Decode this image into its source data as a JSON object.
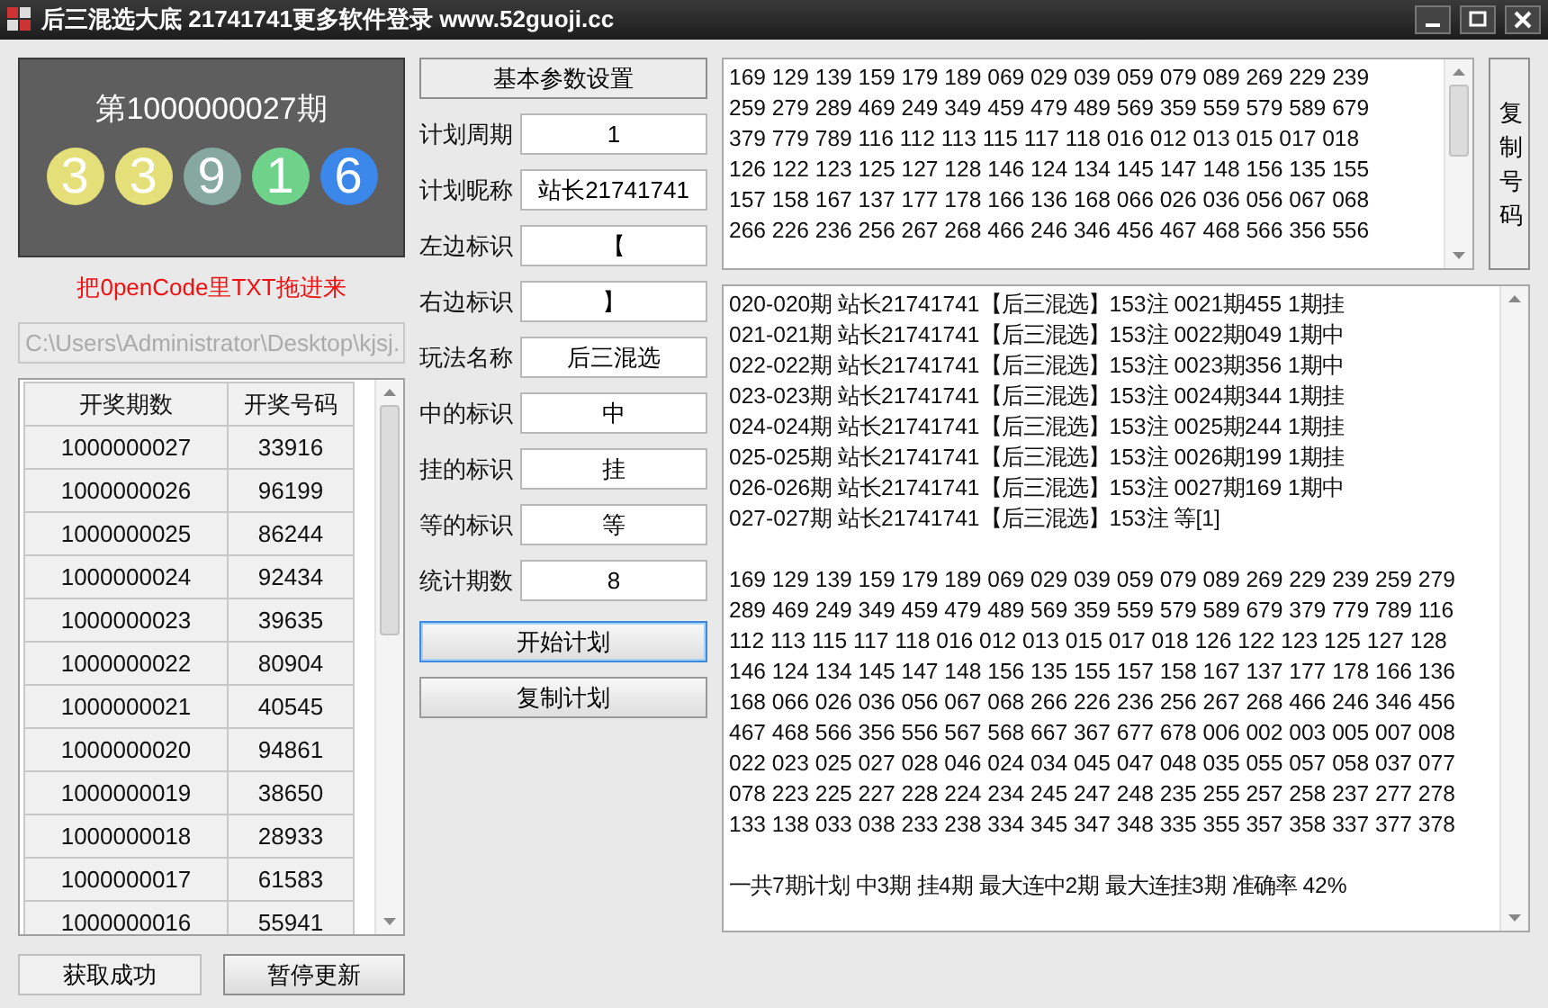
{
  "window": {
    "title": "后三混选大底 21741741更多软件登录 www.52guoji.cc"
  },
  "draw": {
    "period": "第1000000027期",
    "balls": [
      {
        "digit": "3",
        "color": "#e4df78"
      },
      {
        "digit": "3",
        "color": "#e4df78"
      },
      {
        "digit": "9",
        "color": "#86a89f"
      },
      {
        "digit": "1",
        "color": "#6fd28a"
      },
      {
        "digit": "6",
        "color": "#3b87ea"
      }
    ]
  },
  "hint": "把0penCode里TXT拖进来",
  "path_field": {
    "value": "C:\\Users\\Administrator\\Desktop\\kjsj."
  },
  "table": {
    "columns": [
      "开奖期数",
      "开奖号码"
    ],
    "rows": [
      [
        "1000000027",
        "33916"
      ],
      [
        "1000000026",
        "96199"
      ],
      [
        "1000000025",
        "86244"
      ],
      [
        "1000000024",
        "92434"
      ],
      [
        "1000000023",
        "39635"
      ],
      [
        "1000000022",
        "80904"
      ],
      [
        "1000000021",
        "40545"
      ],
      [
        "1000000020",
        "94861"
      ],
      [
        "1000000019",
        "38650"
      ],
      [
        "1000000018",
        "28933"
      ],
      [
        "1000000017",
        "61583"
      ],
      [
        "1000000016",
        "55941"
      ]
    ]
  },
  "left_buttons": [
    "获取成功",
    "暂停更新"
  ],
  "settings_button": "基本参数设置",
  "settings": [
    {
      "label": "计划周期",
      "value": "1"
    },
    {
      "label": "计划昵称",
      "value": "站长21741741"
    },
    {
      "label": "左边标识",
      "value": "【"
    },
    {
      "label": "右边标识",
      "value": "】"
    },
    {
      "label": "玩法名称",
      "value": "后三混选"
    },
    {
      "label": "中的标识",
      "value": "中"
    },
    {
      "label": "挂的标识",
      "value": "挂"
    },
    {
      "label": "等的标识",
      "value": "等"
    },
    {
      "label": "统计期数",
      "value": "8"
    }
  ],
  "action_buttons": [
    {
      "label": "开始计划",
      "selected": true
    },
    {
      "label": "复制计划",
      "selected": false
    }
  ],
  "numbers_box": {
    "lines": [
      "169 129 139 159 179 189 069 029 039 059 079 089 269 229 239",
      "259 279 289 469 249 349 459 479 489 569 359 559 579 589 679",
      "379 779 789 116 112 113 115 117 118 016 012 013 015 017 018",
      "126 122 123 125 127 128 146 124 134 145 147 148 156 135 155",
      "157 158 167 137 177 178 166 136 168 066 026 036 056 067 068",
      "266 226 236 256 267 268 466 246 346 456 467 468 566 356 556"
    ]
  },
  "copy_numbers_button": "复制号码",
  "result_box": {
    "log": [
      "020-020期 站长21741741【后三混选】153注 0021期455 1期挂",
      "021-021期 站长21741741【后三混选】153注 0022期049 1期中",
      "022-022期 站长21741741【后三混选】153注 0023期356 1期中",
      "023-023期 站长21741741【后三混选】153注 0024期344 1期挂",
      "024-024期 站长21741741【后三混选】153注 0025期244 1期挂",
      "025-025期 站长21741741【后三混选】153注 0026期199 1期挂",
      "026-026期 站长21741741【后三混选】153注 0027期169 1期中",
      "027-027期 站长21741741【后三混选】153注 等[1]"
    ],
    "numbers": [
      "169 129 139 159 179 189 069 029 039 059 079 089 269 229 239 259 279",
      "289 469 249 349 459 479 489 569 359 559 579 589 679 379 779 789 116",
      "112 113 115 117 118 016 012 013 015 017 018 126 122 123 125 127 128",
      "146 124 134 145 147 148 156 135 155 157 158 167 137 177 178 166 136",
      "168 066 026 036 056 067 068 266 226 236 256 267 268 466 246 346 456",
      "467 468 566 356 556 567 568 667 367 677 678 006 002 003 005 007 008",
      "022 023 025 027 028 046 024 034 045 047 048 035 055 057 058 037 077",
      "078 223 225 227 228 224 234 245 247 248 235 255 257 258 237 277 278",
      "133 138 033 038 233 238 334 345 347 348 335 355 357 358 337 377 378"
    ],
    "summary": "一共7期计划 中3期 挂4期 最大连中2期 最大连挂3期 准确率 42%"
  }
}
